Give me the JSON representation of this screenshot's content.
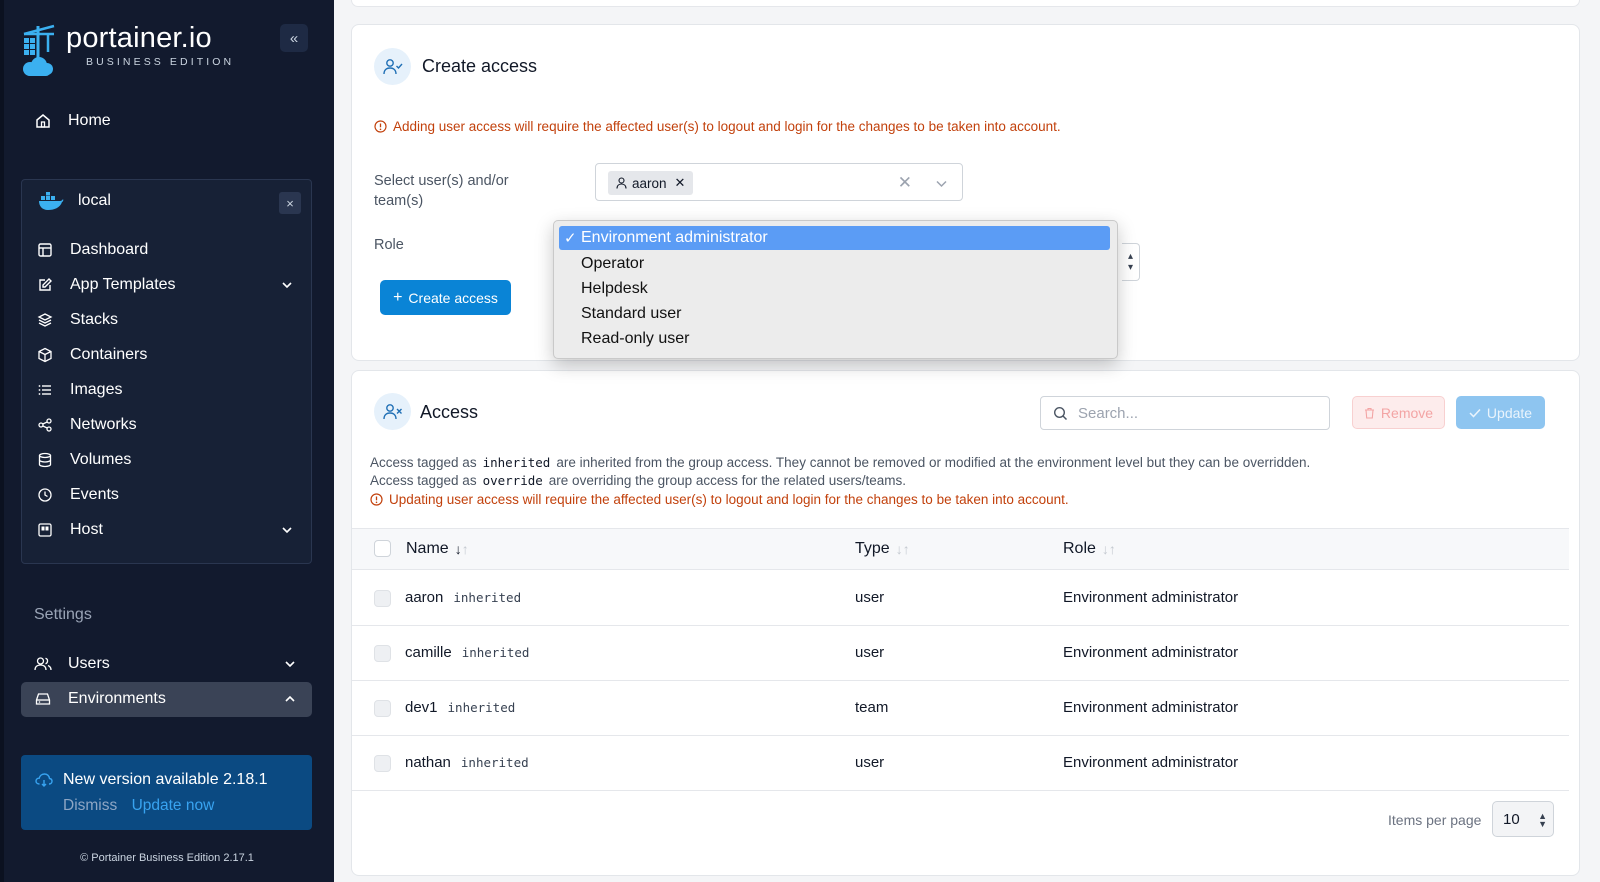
{
  "sidebar": {
    "logo_name": "portainer.io",
    "logo_sub": "BUSINESS EDITION",
    "collapse_label": "«",
    "home": "Home",
    "environment": {
      "name": "local",
      "close": "×",
      "items": [
        "Dashboard",
        "App Templates",
        "Stacks",
        "Containers",
        "Images",
        "Networks",
        "Volumes",
        "Events",
        "Host"
      ]
    },
    "settings_label": "Settings",
    "settings_items": [
      "Users",
      "Environments"
    ],
    "update": {
      "title": "New version available 2.18.1",
      "dismiss": "Dismiss",
      "update_now": "Update now"
    },
    "footer": "Portainer Business Edition 2.17.1"
  },
  "create_access": {
    "title": "Create access",
    "warning": "Adding user access will require the affected user(s) to logout and login for the changes to be taken into account.",
    "select_label": "Select user(s) and/or team(s)",
    "selected_user": "aaron",
    "role_label": "Role",
    "role_options": [
      "Environment administrator",
      "Operator",
      "Helpdesk",
      "Standard user",
      "Read-only user"
    ],
    "selected_role": "Environment administrator",
    "button": "Create access"
  },
  "access": {
    "title": "Access",
    "search_placeholder": "Search...",
    "remove_button": "Remove",
    "update_button": "Update",
    "info1_pre": "Access tagged as",
    "info1_code": "inherited",
    "info1_post": "are inherited from the group access. They cannot be removed or modified at the environment level but they can be overridden.",
    "info2_pre": "Access tagged as",
    "info2_code": "override",
    "info2_post": "are overriding the group access for the related users/teams.",
    "warning": "Updating user access will require the affected user(s) to logout and login for the changes to be taken into account.",
    "columns": [
      "Name",
      "Type",
      "Role"
    ],
    "rows": [
      {
        "name": "aaron",
        "tag": "inherited",
        "type": "user",
        "role": "Environment administrator"
      },
      {
        "name": "camille",
        "tag": "inherited",
        "type": "user",
        "role": "Environment administrator"
      },
      {
        "name": "dev1",
        "tag": "inherited",
        "type": "team",
        "role": "Environment administrator"
      },
      {
        "name": "nathan",
        "tag": "inherited",
        "type": "user",
        "role": "Environment administrator"
      }
    ],
    "items_per_page_label": "Items per page",
    "items_per_page": "10"
  },
  "colors": {
    "sidebar_bg": "#121a2e",
    "primary": "#0a84d6",
    "warning": "#c2410c",
    "dropdown_selected": "#5b9cf5"
  }
}
